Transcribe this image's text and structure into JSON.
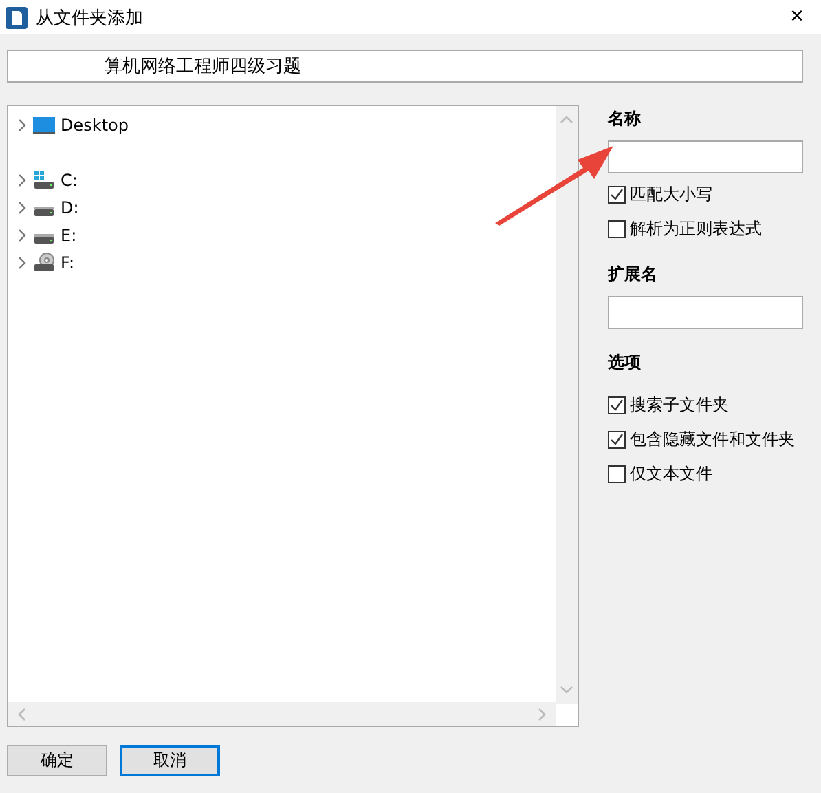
{
  "window": {
    "title": "从文件夹添加",
    "close": "✕"
  },
  "path_field": {
    "value": "算机网络工程师四级习题"
  },
  "tree": {
    "items": [
      {
        "label": "Desktop",
        "kind": "desktop",
        "expanded": false
      },
      {
        "label": "C:",
        "kind": "system-drive",
        "expanded": false
      },
      {
        "label": "D:",
        "kind": "drive",
        "expanded": false
      },
      {
        "label": "E:",
        "kind": "drive",
        "expanded": false
      },
      {
        "label": "F:",
        "kind": "disc-drive",
        "expanded": false
      }
    ]
  },
  "name_section": {
    "heading": "名称",
    "options": [
      {
        "label": "匹配大小写",
        "checked": true
      },
      {
        "label": "解析为正则表达式",
        "checked": false
      }
    ]
  },
  "extension_section": {
    "heading": "扩展名"
  },
  "options_section": {
    "heading": "选项",
    "options": [
      {
        "label": "搜索子文件夹",
        "checked": true
      },
      {
        "label": "包含隐藏文件和文件夹",
        "checked": true
      },
      {
        "label": "仅文本文件",
        "checked": false
      }
    ]
  },
  "buttons": [
    {
      "label": "确定",
      "default": false
    },
    {
      "label": "取消",
      "default": true
    }
  ]
}
